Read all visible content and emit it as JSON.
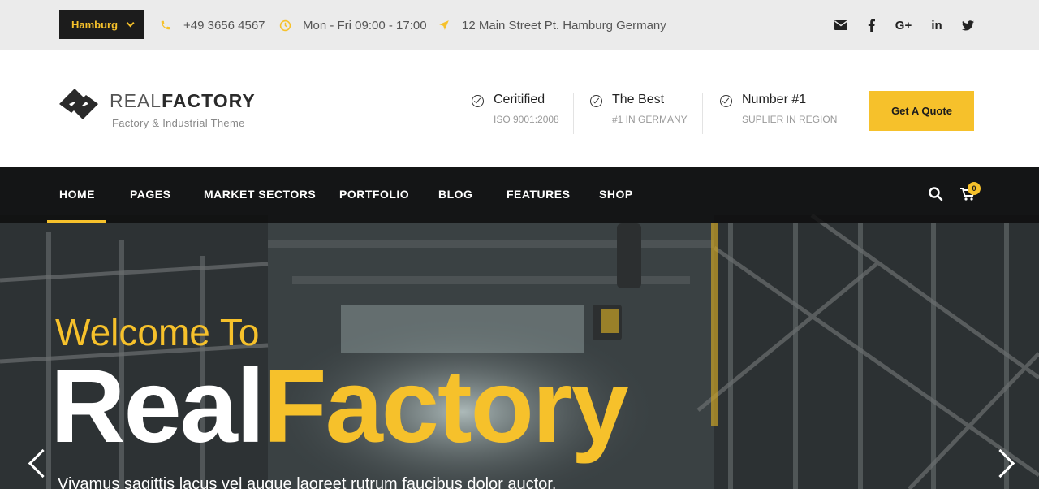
{
  "topbar": {
    "city": "Hamburg",
    "phone": "+49 3656 4567",
    "hours": "Mon - Fri 09:00 - 17:00",
    "address": "12 Main Street Pt. Hamburg Germany",
    "social_icons": [
      "email-icon",
      "facebook-icon",
      "google-plus-icon",
      "linkedin-icon",
      "twitter-icon"
    ],
    "google_plus_glyph": "G+",
    "linkedin_glyph": "in"
  },
  "header": {
    "logo_light": "REAL",
    "logo_bold": "FACTORY",
    "tagline": "Factory & Industrial Theme",
    "features": [
      {
        "title": "Ceritified",
        "subtitle": "ISO 9001:2008"
      },
      {
        "title": "The Best",
        "subtitle": "#1 IN GERMANY"
      },
      {
        "title": "Number #1",
        "subtitle": "SUPLIER IN REGION"
      }
    ],
    "quote_button": "Get A Quote"
  },
  "nav": {
    "items": [
      "HOME",
      "PAGES",
      "MARKET SECTORS",
      "PORTFOLIO",
      "BLOG",
      "FEATURES",
      "SHOP"
    ],
    "active": "HOME",
    "cart_count": "0"
  },
  "hero": {
    "welcome": "Welcome To",
    "title_white": "Real",
    "title_yellow": "Factory",
    "subtext": "Vivamus sagittis lacus vel augue laoreet rutrum faucibus dolor auctor."
  },
  "colors": {
    "accent": "#f6c12b",
    "dark": "#1c1c1c",
    "topbar_bg": "#ebebeb"
  }
}
